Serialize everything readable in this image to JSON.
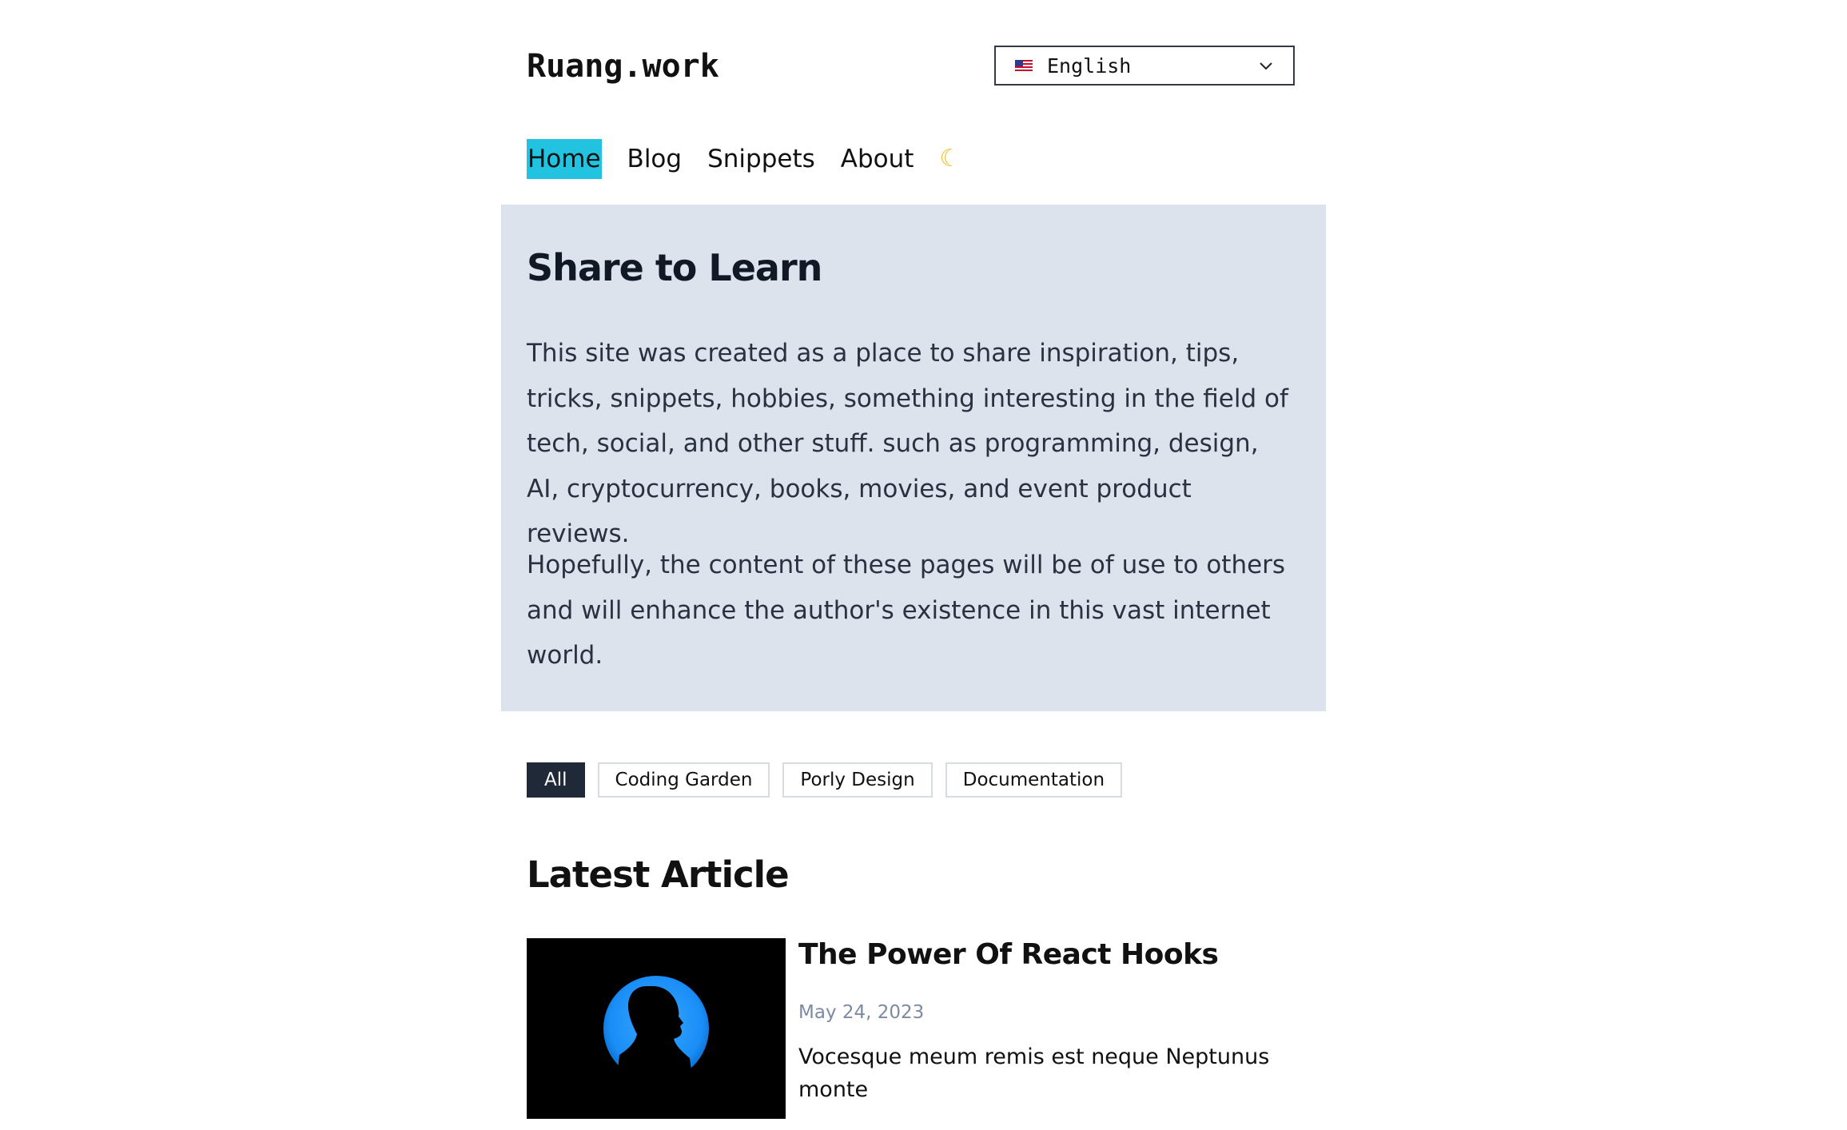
{
  "site": {
    "logo": "Ruang.work"
  },
  "language_select": {
    "selected": "English",
    "flag_icon": "us-flag-icon"
  },
  "nav": {
    "items": [
      {
        "label": "Home",
        "active": true
      },
      {
        "label": "Blog",
        "active": false
      },
      {
        "label": "Snippets",
        "active": false
      },
      {
        "label": "About",
        "active": false
      }
    ],
    "theme_toggle_icon": "moon-icon",
    "accent": "#22c3e0"
  },
  "hero": {
    "title": "Share to Learn",
    "paragraph1": "This site was created as a place to share inspiration, tips, tricks, snippets, hobbies, something interesting in the field of tech, social, and other stuff. such as programming, design, AI, cryptocurrency, books, movies, and event product reviews.",
    "paragraph2": "Hopefully, the content of these pages will be of use to others and will enhance the author's existence in this vast internet world.",
    "background": "#dce3ed"
  },
  "filters": {
    "items": [
      {
        "label": "All",
        "active": true
      },
      {
        "label": "Coding Garden",
        "active": false
      },
      {
        "label": "Porly Design",
        "active": false
      },
      {
        "label": "Documentation",
        "active": false
      }
    ]
  },
  "latest": {
    "heading": "Latest Article",
    "articles": [
      {
        "title": "The Power Of React Hooks",
        "date": "May 24, 2023",
        "description": "Vocesque meum remis est neque Neptunus monte",
        "thumbnail": "silhouette-profile-image"
      }
    ]
  }
}
